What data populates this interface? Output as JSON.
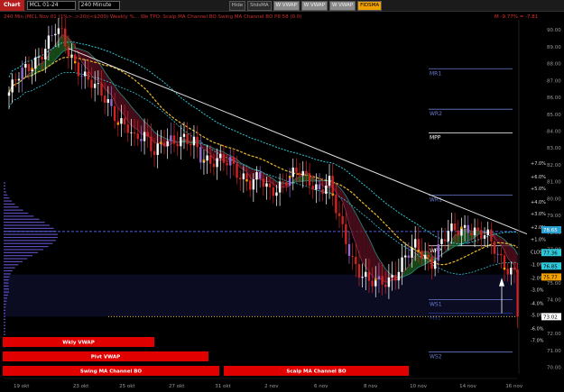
{
  "toolbar": {
    "chart_label": "Chart",
    "symbol": "MCL 01-24",
    "interval": "240 Minute",
    "buttons": [
      "Hide",
      "StdsMA",
      "W VWAP",
      "W VWAP",
      "W VWAP",
      "FIDSMA"
    ]
  },
  "colors": {
    "candle_up": "#ffffff",
    "candle_down": "#d22222",
    "candle_neutral": "#9a6bd1",
    "ma_yellow": "#e8b830",
    "ma_cyan": "#30c8d8",
    "trend": "#e0e0e0",
    "cloud_down": "#5a1020",
    "cloud_up": "#1f6020",
    "profile": "#6a5ad8"
  },
  "header": {
    "info_text": "240 Min (MCL Nov 01 (1%>..>20)(<$200) Weekly %... We TPO: Scalp MA Channel BO  Swing MA Channel BO  P8 58 (0.0)",
    "change_text": "M -9.77% = -7.81"
  },
  "price_axis": {
    "labels": [
      "90.00",
      "89.00",
      "88.00",
      "87.00",
      "86.00",
      "85.00",
      "84.00",
      "83.00",
      "82.00",
      "81.00",
      "80.00",
      "79.00",
      "78.00",
      "77.00",
      "76.00",
      "75.00",
      "74.00",
      "73.00",
      "72.00",
      "71.00",
      "70.00"
    ],
    "values": [
      90,
      89,
      88,
      87,
      86,
      85,
      84,
      83,
      82,
      81,
      80,
      79,
      78,
      77,
      76,
      75,
      74,
      73,
      72,
      71,
      70
    ],
    "min": 69.6,
    "max": 90.6
  },
  "percent_axis": {
    "labels": [
      "+7.0%",
      "+6.0%",
      "+5.0%",
      "+4.0%",
      "+3.0%",
      "+2.0%",
      "+1.0%",
      "CLOSE",
      "-1.0%",
      "-2.0%",
      "-3.0%",
      "-4.0%",
      "-5.0%",
      "-6.0%",
      "-7.0%"
    ],
    "prices": [
      82.1,
      81.3,
      80.6,
      79.8,
      79.1,
      78.3,
      77.6,
      76.85,
      76.1,
      75.3,
      74.6,
      73.8,
      73.1,
      72.3,
      71.6
    ]
  },
  "price_tags": [
    {
      "text": "78.65",
      "price": 78.15,
      "bg": "#2aa0d0",
      "fg": "#ffffff"
    },
    {
      "text": "77.36",
      "price": 76.8,
      "bg": "#30c8d8",
      "fg": "#000000"
    },
    {
      "text": "76.85",
      "price": 76.0,
      "bg": "#30c8d8",
      "fg": "#000000"
    },
    {
      "text": "75.77",
      "price": 75.35,
      "bg": "#f0a000",
      "fg": "#000000"
    },
    {
      "text": "73.02",
      "price": 73.0,
      "bg": "#ffffff",
      "fg": "#000000"
    }
  ],
  "time_axis": {
    "labels": [
      "19 okt",
      "23 okt",
      "25 okt",
      "27 okt",
      "31 okt",
      "2 nov",
      "6 nov",
      "8 nov",
      "10 nov",
      "14 nov",
      "16 nov"
    ],
    "bars": [
      3,
      21,
      35,
      50,
      64,
      79,
      94,
      109,
      123,
      138,
      152
    ]
  },
  "pivots": [
    {
      "label": "MR1",
      "price": 87.7,
      "color": "#6a7ad0"
    },
    {
      "label": "WR2",
      "price": 85.3,
      "color": "#6a7ad0"
    },
    {
      "label": "MPP",
      "price": 83.9,
      "color": "#ffffff"
    },
    {
      "label": "WR1",
      "price": 80.2,
      "color": "#6a7ad0"
    },
    {
      "label": "WPP",
      "price": 77.2,
      "color": "#ffffff"
    },
    {
      "label": "WS1",
      "price": 74.0,
      "color": "#6a7ad0"
    },
    {
      "label": "MS1",
      "price": 73.2,
      "color": "#2a3a9a"
    },
    {
      "label": "WS2",
      "price": 70.9,
      "color": "#6a7ad0"
    }
  ],
  "levels": {
    "blue_dashed": 78.05,
    "yellow_dotted": 73.0,
    "band_top": 75.5,
    "band_bottom": 73.0
  },
  "indicator_boxes": [
    {
      "label": "Wkly VWAP"
    },
    {
      "label": "Pivt VWAP"
    },
    {
      "label": "Swing MA Channel BO"
    },
    {
      "label": "Scalp MA Channel BO"
    }
  ],
  "chart_data": {
    "type": "candlestick",
    "bar_count": 155,
    "key_closes": [
      [
        0,
        86.3
      ],
      [
        3,
        87.2
      ],
      [
        6,
        87.8
      ],
      [
        9,
        88.5
      ],
      [
        12,
        89.3
      ],
      [
        14,
        89.9
      ],
      [
        16,
        89.6
      ],
      [
        18,
        88.7
      ],
      [
        21,
        87.8
      ],
      [
        24,
        87.0
      ],
      [
        27,
        86.3
      ],
      [
        30,
        85.7
      ],
      [
        33,
        84.8
      ],
      [
        36,
        84.2
      ],
      [
        38,
        83.3
      ],
      [
        41,
        83.7
      ],
      [
        44,
        83.0
      ],
      [
        47,
        83.5
      ],
      [
        50,
        83.1
      ],
      [
        53,
        83.5
      ],
      [
        56,
        83.6
      ],
      [
        58,
        82.6
      ],
      [
        61,
        81.9
      ],
      [
        64,
        82.2
      ],
      [
        67,
        82.4
      ],
      [
        70,
        81.4
      ],
      [
        73,
        80.7
      ],
      [
        76,
        81.2
      ],
      [
        79,
        80.6
      ],
      [
        82,
        80.8
      ],
      [
        85,
        81.1
      ],
      [
        88,
        81.6
      ],
      [
        91,
        81.2
      ],
      [
        94,
        80.5
      ],
      [
        97,
        80.8
      ],
      [
        99,
        79.3
      ],
      [
        101,
        78.2
      ],
      [
        104,
        76.5
      ],
      [
        106,
        75.7
      ],
      [
        109,
        74.9
      ],
      [
        112,
        75.0
      ],
      [
        115,
        75.3
      ],
      [
        117,
        75.6
      ],
      [
        120,
        76.4
      ],
      [
        123,
        77.1
      ],
      [
        125,
        76.8
      ],
      [
        128,
        76.3
      ],
      [
        131,
        77.4
      ],
      [
        133,
        77.9
      ],
      [
        136,
        78.1
      ],
      [
        139,
        78.4
      ],
      [
        142,
        78.0
      ],
      [
        145,
        77.6
      ],
      [
        148,
        76.6
      ],
      [
        151,
        76.0
      ],
      [
        153,
        75.7
      ],
      [
        154,
        73.0
      ]
    ]
  }
}
